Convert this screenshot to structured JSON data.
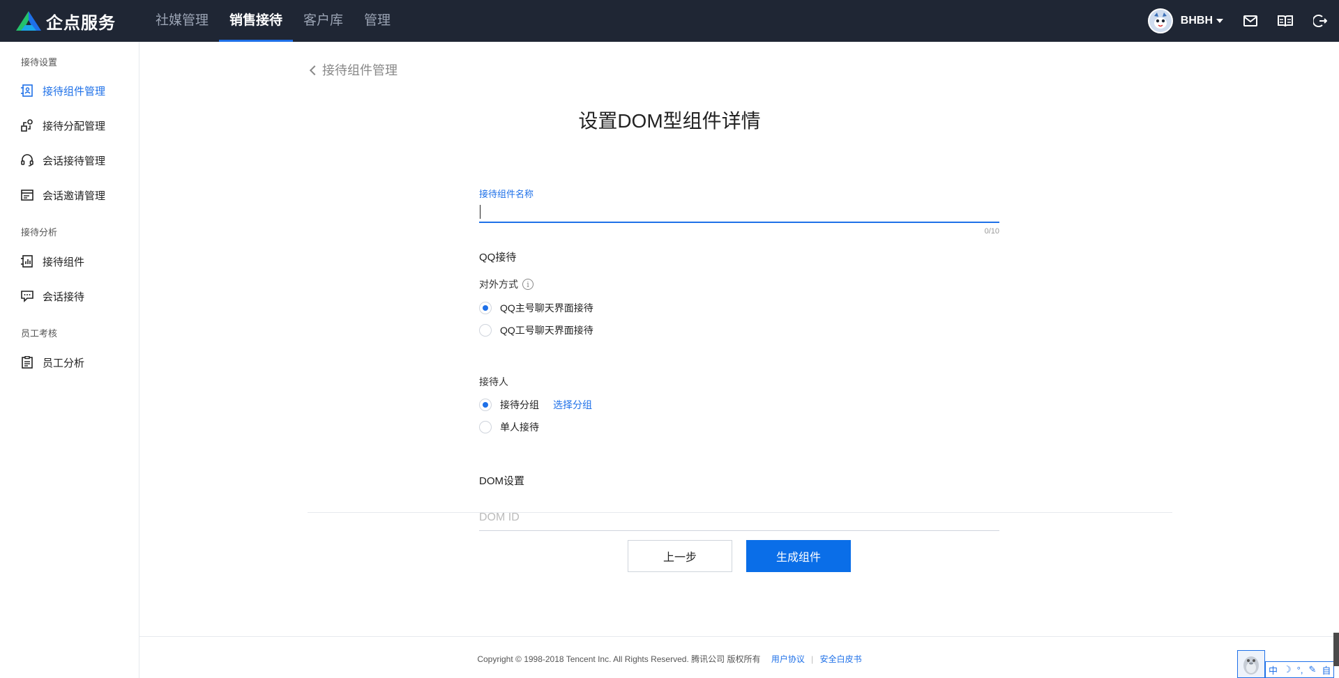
{
  "brand": {
    "name": "企点服务"
  },
  "topnav": [
    {
      "label": "社媒管理",
      "active": false
    },
    {
      "label": "销售接待",
      "active": true
    },
    {
      "label": "客户库",
      "active": false
    },
    {
      "label": "管理",
      "active": false
    }
  ],
  "user": {
    "name": "BHBH"
  },
  "sidebar": {
    "group1": "接待设置",
    "item1": "接待组件管理",
    "item2": "接待分配管理",
    "item3": "会话接待管理",
    "item4": "会话邀请管理",
    "group2": "接待分析",
    "item5": "接待组件",
    "item6": "会话接待",
    "group3": "员工考核",
    "item7": "员工分析"
  },
  "main": {
    "back_label": "接待组件管理",
    "title": "设置DOM型组件详情",
    "name_field": {
      "label": "接待组件名称",
      "value": "",
      "counter": "0/10"
    },
    "qq_section": "QQ接待",
    "external_label": "对外方式",
    "info_icon": "i",
    "external_options": [
      {
        "label": "QQ主号聊天界面接待",
        "checked": true
      },
      {
        "label": "QQ工号聊天界面接待",
        "checked": false
      }
    ],
    "receiver_label": "接待人",
    "receiver_options": [
      {
        "label": "接待分组",
        "checked": true,
        "link": "选择分组"
      },
      {
        "label": "单人接待",
        "checked": false
      }
    ],
    "dom_section": "DOM设置",
    "dom_field": {
      "placeholder": "DOM ID",
      "value": ""
    },
    "prev_button": "上一步",
    "generate_button": "生成组件"
  },
  "footer": {
    "copyright": "Copyright © 1998-2018 Tencent Inc. All Rights Reserved. 腾讯公司 版权所有",
    "link1": "用户协议",
    "separator": "|",
    "link2": "安全白皮书"
  },
  "ime": {
    "mode": "中",
    "symbols": [
      "☽",
      "°,",
      "✎",
      "自"
    ]
  },
  "colors": {
    "accent": "#1e70e8",
    "topbar": "#1f2634"
  }
}
